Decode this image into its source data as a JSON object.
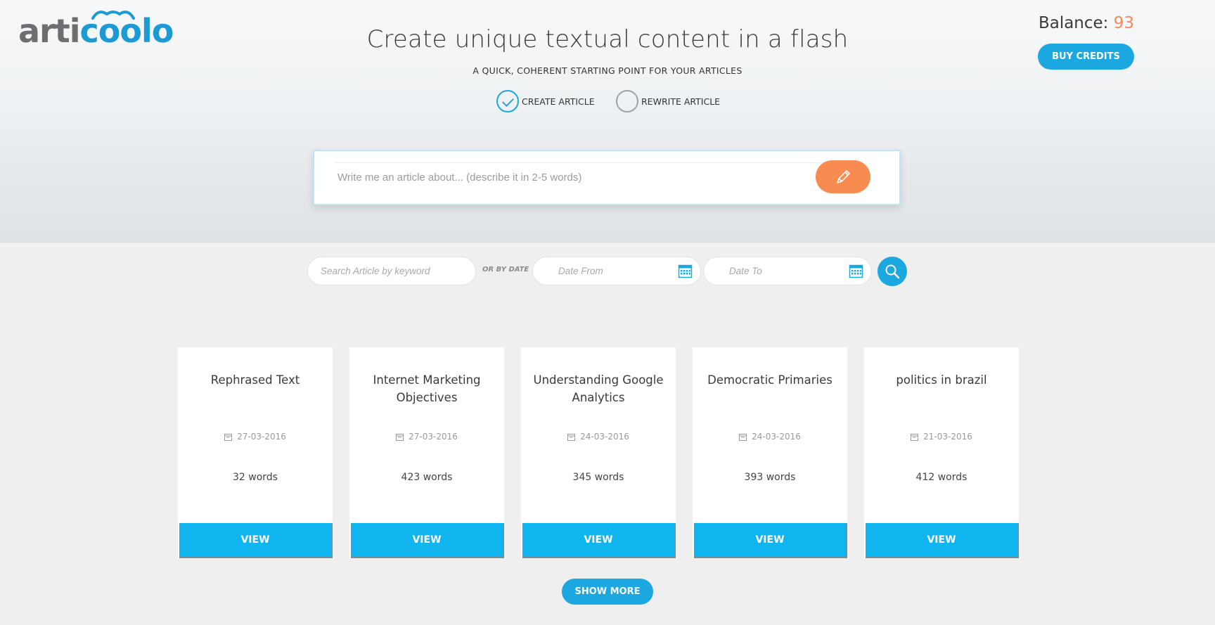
{
  "brand": {
    "logo_text_gray": "arti",
    "logo_text_blue": "coolo"
  },
  "hero": {
    "headline": "Create unique textual content in a flash",
    "subline": "A QUICK, COHERENT STARTING POINT FOR YOUR ARTICLES",
    "modes": [
      {
        "label": "CREATE ARTICLE",
        "selected": true
      },
      {
        "label": "REWRITE ARTICLE",
        "selected": false
      }
    ]
  },
  "account": {
    "balance_label": "Balance:",
    "balance_value": "93",
    "buy_label": "BUY CREDITS"
  },
  "prompt": {
    "placeholder": "Write me an article about... (describe it in 2-5 words)",
    "value": "",
    "submit_icon": "pencil-icon"
  },
  "filters": {
    "keyword_placeholder": "Search Article by keyword",
    "or_by_date": "OR BY DATE",
    "date_from_placeholder": "Date From",
    "date_to_placeholder": "Date To",
    "calendar_icon": "calendar-icon",
    "search_icon": "search-icon"
  },
  "articles": [
    {
      "title": "Rephrased Text",
      "date": "27-03-2016",
      "words": "32 words",
      "view_label": "VIEW"
    },
    {
      "title": "Internet Marketing Objectives",
      "date": "27-03-2016",
      "words": "423 words",
      "view_label": "VIEW"
    },
    {
      "title": "Understanding Google Analytics",
      "date": "24-03-2016",
      "words": "345 words",
      "view_label": "VIEW"
    },
    {
      "title": "Democratic Primaries",
      "date": "24-03-2016",
      "words": "393 words",
      "view_label": "VIEW"
    },
    {
      "title": "politics in brazil",
      "date": "21-03-2016",
      "words": "412 words",
      "view_label": "VIEW"
    }
  ],
  "show_more_label": "SHOW MORE",
  "colors": {
    "accent": "#1ba8e0",
    "orange": "#f88b4f",
    "view_button": "#10b5ef",
    "balance_value": "#f38a5a"
  }
}
